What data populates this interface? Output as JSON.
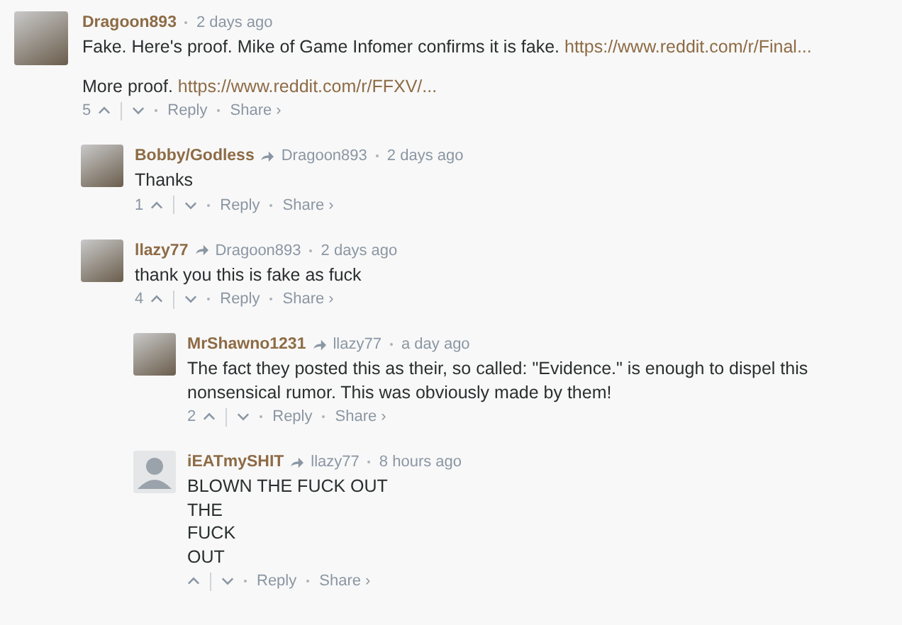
{
  "comments": [
    {
      "author": "Dragoon893",
      "time": "2 days ago",
      "avatar": {
        "kind": "image"
      },
      "paragraphs": [
        [
          {
            "kind": "text",
            "text": "Fake. Here's proof. Mike of Game Infomer confirms it is fake. "
          },
          {
            "kind": "link",
            "text": "https://www.reddit.com/r/Final..."
          }
        ],
        [
          {
            "kind": "text",
            "text": "More proof. "
          },
          {
            "kind": "link",
            "text": "https://www.reddit.com/r/FFXV/..."
          }
        ]
      ],
      "score": "5",
      "reply": "Reply",
      "share": "Share ›",
      "children": [
        {
          "author": "Bobby/Godless",
          "reply_to": "Dragoon893",
          "time": "2 days ago",
          "avatar": {
            "kind": "image"
          },
          "paragraphs": [
            [
              {
                "kind": "text",
                "text": "Thanks"
              }
            ]
          ],
          "score": "1",
          "reply": "Reply",
          "share": "Share ›"
        },
        {
          "author": "llazy77",
          "reply_to": "Dragoon893",
          "time": "2 days ago",
          "avatar": {
            "kind": "image"
          },
          "paragraphs": [
            [
              {
                "kind": "text",
                "text": "thank you this is fake as fuck"
              }
            ]
          ],
          "score": "4",
          "reply": "Reply",
          "share": "Share ›",
          "children": [
            {
              "author": "MrShawno1231",
              "reply_to": "llazy77",
              "time": "a day ago",
              "avatar": {
                "kind": "image"
              },
              "paragraphs": [
                [
                  {
                    "kind": "text",
                    "text": "The fact they posted this as their, so called: \"Evidence.\" is enough to dispel this nonsensical rumor. This was obviously made by them!"
                  }
                ]
              ],
              "score": "2",
              "reply": "Reply",
              "share": "Share ›"
            },
            {
              "author": "iEATmySHIT",
              "reply_to": "llazy77",
              "time": "8 hours ago",
              "avatar": {
                "kind": "default"
              },
              "paragraphs": [
                [
                  {
                    "kind": "text",
                    "text": "BLOWN THE FUCK OUT\nTHE\nFUCK\nOUT"
                  }
                ]
              ],
              "reply": "Reply",
              "share": "Share ›"
            }
          ]
        }
      ]
    }
  ]
}
